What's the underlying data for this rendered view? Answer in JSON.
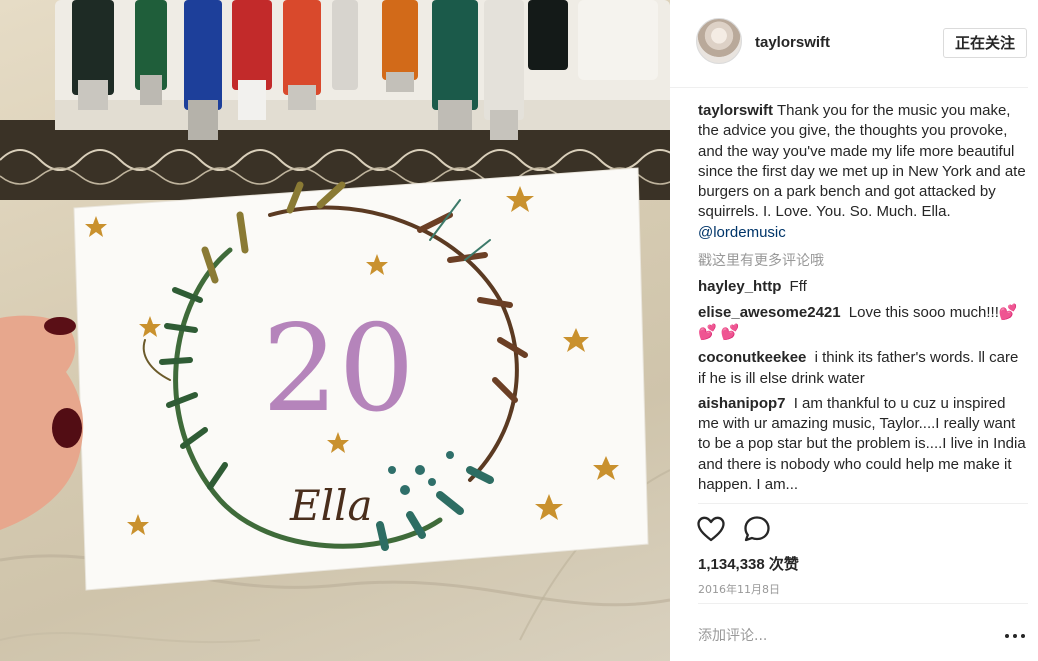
{
  "post": {
    "author": "taylorswift",
    "follow_label": "正在关注",
    "caption": {
      "username": "taylorswift",
      "text": "Thank you for the music you make, the advice you give, the thoughts you provoke, and the way you've made my life more beautiful since the first day we met up in New York and ate burgers on a park bench and got attacked by squirrels. I. Love. You. So. Much. Ella.",
      "mention": "@lordemusic"
    },
    "load_more_label": "戳这里有更多评论哦",
    "comments": [
      {
        "username": "hayley_http",
        "text": "Fff"
      },
      {
        "username": "elise_awesome2421",
        "text": "Love this sooo much!!!💕 💕 💕"
      },
      {
        "username": "coconutkeekee",
        "text": "i think its father's words. ll care if he is ill else drink water"
      },
      {
        "username": "aishanipop7",
        "text": "I am thankful to u cuz u inspired me with ur amazing music, Taylor....I really want to be a pop star but the problem is....I live in India and there is nobody who could help me make it happen. I am..."
      }
    ],
    "likes_count": "1,134,338",
    "likes_unit": "次赞",
    "date": "2016年11月8日",
    "comment_placeholder": "添加评论..."
  },
  "photo": {
    "card_number": "20",
    "card_signature": "Ella",
    "icons": {
      "like": "heart-outline-icon",
      "comment": "speech-bubble-icon",
      "more": "ellipsis-icon"
    }
  },
  "colors": {
    "text": "#262626",
    "muted": "#999999",
    "link": "#003569",
    "border": "#dbdbdb"
  }
}
